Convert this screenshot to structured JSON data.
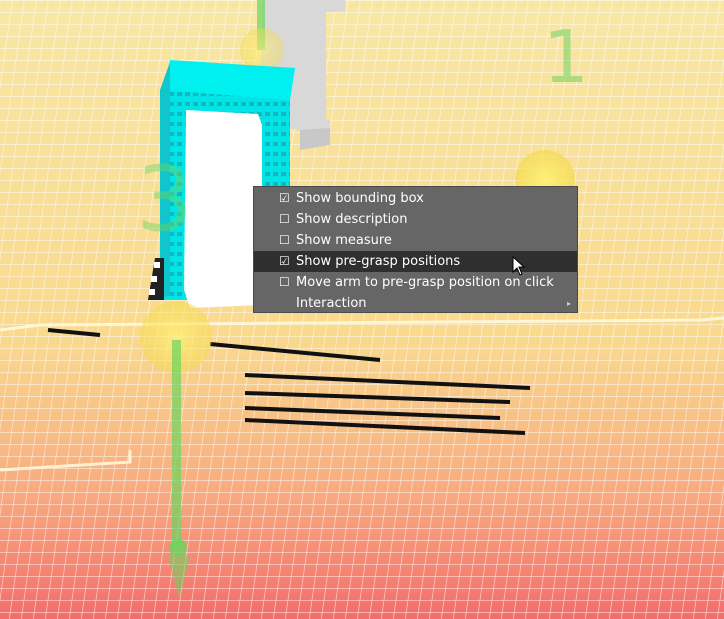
{
  "scene": {
    "marker_numbers": [
      "1",
      "3"
    ]
  },
  "context_menu": {
    "items": [
      {
        "check": "☑",
        "label": "Show bounding box",
        "active": false
      },
      {
        "check": "☐",
        "label": "Show description",
        "active": false
      },
      {
        "check": "☐",
        "label": "Show measure",
        "active": false
      },
      {
        "check": "☑",
        "label": "Show pre-grasp positions",
        "active": true
      },
      {
        "check": "☐",
        "label": "Move arm to pre-grasp position on click",
        "active": false
      },
      {
        "check": "",
        "label": "Interaction",
        "active": false,
        "submenu_arrow": "▸"
      }
    ]
  },
  "colors": {
    "floor_top": "#f9e9a6",
    "floor_bottom": "#f46e6b",
    "box_face": "#00e8e8",
    "menu_bg": "#666666",
    "menu_highlight": "#2f2f2f",
    "marker_green": "#6cd45e"
  }
}
